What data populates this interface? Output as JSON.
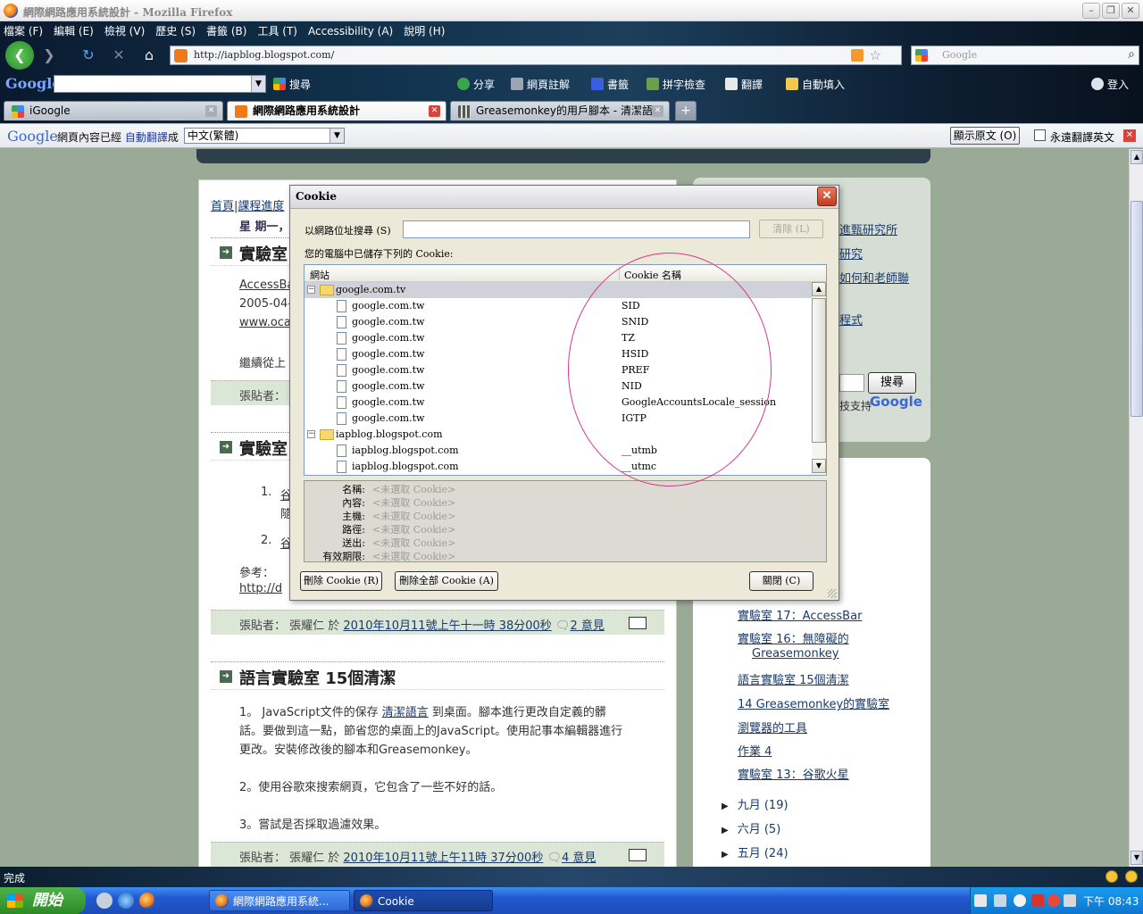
{
  "window": {
    "title": "網際網路應用系統設計 - Mozilla Firefox"
  },
  "menu": [
    "檔案 (F)",
    "編輯 (E)",
    "檢視 (V)",
    "歷史 (S)",
    "書籤 (B)",
    "工具 (T)",
    "Accessibility (A)",
    "說明 (H)"
  ],
  "nav": {
    "url": "http://iapblog.blogspot.com/",
    "search_placeholder": "Google"
  },
  "google_toolbar": {
    "logo": "Google",
    "items": [
      "搜尋",
      "分享",
      "網頁註解",
      "書籤",
      "拼字檢查",
      "翻譯",
      "自動填入",
      "登入"
    ]
  },
  "tabs": [
    {
      "label": "iGoogle"
    },
    {
      "label": "網際網路應用系統設計"
    },
    {
      "label": "Greasemonkey的用戶腳本 - 清潔語…"
    }
  ],
  "translate": {
    "logo": "Google",
    "msg_pre": "網頁內容已經",
    "msg_link": "自動翻譯",
    "msg_post": "成",
    "language": "中文(繁體)",
    "show_original": "顯示原文 (O)",
    "never_translate": "永遠翻譯英文"
  },
  "page": {
    "breadcrumb_home": "首頁",
    "breadcrumb_sep": "|",
    "breadcrumb_progress": "課程進度",
    "date_header": "星 期一，",
    "post1": {
      "title": "實驗室",
      "line1": "AccessBa",
      "line2": "2005-04-0",
      "line3": "www.oca",
      "line4": "繼續從上",
      "footer": "張貼者："
    },
    "post2": {
      "title": "實驗室",
      "item1_num": "1.",
      "item1": "谷",
      "item1b": "隨",
      "item2_num": "2.",
      "item2": "谷",
      "ref": "參考：",
      "ref_link": "http://d",
      "footer_pre": "張貼者： 張耀仁 於",
      "footer_link": "2010年10月11號上午十一時 38分00秒",
      "comments": "2 意見"
    },
    "post3": {
      "title": "語言實驗室 15個清潔",
      "p1_pre": "1。 JavaScript文件的保存",
      "p1_link": "清潔語言",
      "p1_post": "到桌面。腳本進行更改自定義的髒",
      "p1_l2": "話。要做到這一點，節省您的桌面上的JavaScript。使用記事本編輯器進行",
      "p1_l3": "更改。安裝修改後的腳本和Greasemonkey。",
      "p2": "2。使用谷歌來搜索網頁，它包含了一些不好的話。",
      "p3": "3。嘗試是否採取過濾效果。",
      "footer_pre": "張貼者： 張耀仁 於",
      "footer_link": "2010年10月11號上午11時 37分00秒",
      "comments": "4 意見"
    },
    "side1": {
      "l1": "進甄研究所",
      "l2": "研究",
      "l3": "如何和老師聯",
      "l4": "程式",
      "search_btn": "搜尋",
      "powered": "技支持",
      "google": "Google"
    },
    "side_links": [
      "實驗室 17：AccessBar",
      "實驗室 16：無障礙的",
      "Greasemonkey",
      "語言實驗室 15個清潔",
      "14 Greasemonkey的實驗室",
      "瀏覽器的工具",
      "作業 4",
      "實驗室 13：谷歌火星"
    ],
    "archive": [
      {
        "label": "九月",
        "count": "(19)"
      },
      {
        "label": "六月",
        "count": "(5)"
      },
      {
        "label": "五月",
        "count": "(24)"
      }
    ]
  },
  "dialog": {
    "title": "Cookie",
    "search_label": "以網路位址搜尋 (S)",
    "clear_button": "清除 (L)",
    "stored_label": "您的電腦中已儲存下列的 Cookie:",
    "col_site": "網站",
    "col_name": "Cookie 名稱",
    "rows": [
      {
        "site": "google.com.tv",
        "name": "",
        "folder": true,
        "selected": true
      },
      {
        "site": "google.com.tw",
        "name": "SID"
      },
      {
        "site": "google.com.tw",
        "name": "SNID"
      },
      {
        "site": "google.com.tw",
        "name": "TZ"
      },
      {
        "site": "google.com.tw",
        "name": "HSID"
      },
      {
        "site": "google.com.tw",
        "name": "PREF"
      },
      {
        "site": "google.com.tw",
        "name": "NID"
      },
      {
        "site": "google.com.tw",
        "name": "GoogleAccountsLocale_session"
      },
      {
        "site": "google.com.tw",
        "name": "IGTP"
      },
      {
        "site": "iapblog.blogspot.com",
        "name": "",
        "folder": true
      },
      {
        "site": "iapblog.blogspot.com",
        "name": "__utmb"
      },
      {
        "site": "iapblog.blogspot.com",
        "name": "__utmc"
      }
    ],
    "details": [
      {
        "key": "名稱:",
        "value": "<未選取 Cookie>"
      },
      {
        "key": "內容:",
        "value": "<未選取 Cookie>"
      },
      {
        "key": "主機:",
        "value": "<未選取 Cookie>"
      },
      {
        "key": "路徑:",
        "value": "<未選取 Cookie>"
      },
      {
        "key": "送出:",
        "value": "<未選取 Cookie>"
      },
      {
        "key": "有效期限:",
        "value": "<未選取 Cookie>"
      }
    ],
    "delete_btn": "刪除 Cookie (R)",
    "delete_all_btn": "刪除全部 Cookie (A)",
    "close_btn": "關閉 (C)"
  },
  "status": {
    "text": "完成"
  },
  "taskbar": {
    "start": "開始",
    "tasks": [
      "網際網路應用系統...",
      "Cookie"
    ],
    "clock": "下午 08:43"
  },
  "colors": {
    "annotation": "#d8378f",
    "link": "#1a3a6a",
    "post_footer": "#dbe6d6"
  }
}
